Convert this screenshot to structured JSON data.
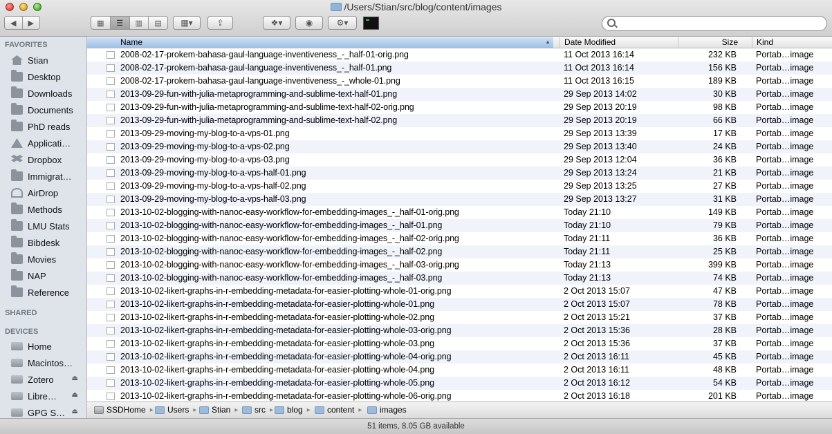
{
  "window": {
    "title": "/Users/Stian/src/blog/content/images"
  },
  "toolbar": {
    "back_icon": "back-arrow-icon",
    "forward_icon": "forward-arrow-icon",
    "views": [
      "icon-view",
      "list-view",
      "column-view",
      "coverflow-view"
    ],
    "active_view": "list-view",
    "search": {
      "value": "",
      "placeholder": ""
    }
  },
  "sidebar": {
    "favorites_label": "FAVORITES",
    "favorites": [
      {
        "label": "Stian",
        "icon": "home-icon"
      },
      {
        "label": "Desktop",
        "icon": "folder-icon"
      },
      {
        "label": "Downloads",
        "icon": "folder-icon"
      },
      {
        "label": "Documents",
        "icon": "folder-icon"
      },
      {
        "label": "PhD reads",
        "icon": "folder-icon"
      },
      {
        "label": "Applicati…",
        "icon": "applications-icon"
      },
      {
        "label": "Dropbox",
        "icon": "dropbox-icon"
      },
      {
        "label": "Immigrat…",
        "icon": "folder-icon"
      },
      {
        "label": "AirDrop",
        "icon": "airdrop-icon"
      },
      {
        "label": "Methods",
        "icon": "folder-icon"
      },
      {
        "label": "LMU Stats",
        "icon": "folder-icon"
      },
      {
        "label": "Bibdesk",
        "icon": "folder-icon"
      },
      {
        "label": "Movies",
        "icon": "folder-icon"
      },
      {
        "label": "NAP",
        "icon": "folder-icon"
      },
      {
        "label": "Reference",
        "icon": "folder-icon"
      }
    ],
    "shared_label": "SHARED",
    "devices_label": "DEVICES",
    "devices": [
      {
        "label": "Home",
        "icon": "disk-icon"
      },
      {
        "label": "Macintos…",
        "icon": "disk-icon"
      },
      {
        "label": "Zotero",
        "icon": "disk-icon",
        "eject": true
      },
      {
        "label": "Libre…",
        "icon": "disk-icon",
        "eject": true
      },
      {
        "label": "GPG S…",
        "icon": "disk-icon",
        "eject": true
      }
    ]
  },
  "columns": {
    "name": "Name",
    "date": "Date Modified",
    "size": "Size",
    "kind": "Kind"
  },
  "files": [
    {
      "name": "2008-02-17-prokem-bahasa-gaul-language-inventiveness_-_half-01-orig.png",
      "date": "11 Oct 2013 16:14",
      "size": "232 KB",
      "kind": "Portab…image"
    },
    {
      "name": "2008-02-17-prokem-bahasa-gaul-language-inventiveness_-_half-01.png",
      "date": "11 Oct 2013 16:14",
      "size": "156 KB",
      "kind": "Portab…image"
    },
    {
      "name": "2008-02-17-prokem-bahasa-gaul-language-inventiveness_-_whole-01.png",
      "date": "11 Oct 2013 16:15",
      "size": "189 KB",
      "kind": "Portab…image"
    },
    {
      "name": "2013-09-29-fun-with-julia-metaprogramming-and-sublime-text-half-01.png",
      "date": "29 Sep 2013 14:02",
      "size": "30 KB",
      "kind": "Portab…image"
    },
    {
      "name": "2013-09-29-fun-with-julia-metaprogramming-and-sublime-text-half-02-orig.png",
      "date": "29 Sep 2013 20:19",
      "size": "98 KB",
      "kind": "Portab…image"
    },
    {
      "name": "2013-09-29-fun-with-julia-metaprogramming-and-sublime-text-half-02.png",
      "date": "29 Sep 2013 20:19",
      "size": "66 KB",
      "kind": "Portab…image"
    },
    {
      "name": "2013-09-29-moving-my-blog-to-a-vps-01.png",
      "date": "29 Sep 2013 13:39",
      "size": "17 KB",
      "kind": "Portab…image"
    },
    {
      "name": "2013-09-29-moving-my-blog-to-a-vps-02.png",
      "date": "29 Sep 2013 13:40",
      "size": "24 KB",
      "kind": "Portab…image"
    },
    {
      "name": "2013-09-29-moving-my-blog-to-a-vps-03.png",
      "date": "29 Sep 2013 12:04",
      "size": "36 KB",
      "kind": "Portab…image"
    },
    {
      "name": "2013-09-29-moving-my-blog-to-a-vps-half-01.png",
      "date": "29 Sep 2013 13:24",
      "size": "21 KB",
      "kind": "Portab…image"
    },
    {
      "name": "2013-09-29-moving-my-blog-to-a-vps-half-02.png",
      "date": "29 Sep 2013 13:25",
      "size": "27 KB",
      "kind": "Portab…image"
    },
    {
      "name": "2013-09-29-moving-my-blog-to-a-vps-half-03.png",
      "date": "29 Sep 2013 13:27",
      "size": "31 KB",
      "kind": "Portab…image"
    },
    {
      "name": "2013-10-02-blogging-with-nanoc-easy-workflow-for-embedding-images_-_half-01-orig.png",
      "date": "Today 21:10",
      "size": "149 KB",
      "kind": "Portab…image"
    },
    {
      "name": "2013-10-02-blogging-with-nanoc-easy-workflow-for-embedding-images_-_half-01.png",
      "date": "Today 21:10",
      "size": "79 KB",
      "kind": "Portab…image"
    },
    {
      "name": "2013-10-02-blogging-with-nanoc-easy-workflow-for-embedding-images_-_half-02-orig.png",
      "date": "Today 21:11",
      "size": "36 KB",
      "kind": "Portab…image"
    },
    {
      "name": "2013-10-02-blogging-with-nanoc-easy-workflow-for-embedding-images_-_half-02.png",
      "date": "Today 21:11",
      "size": "25 KB",
      "kind": "Portab…image"
    },
    {
      "name": "2013-10-02-blogging-with-nanoc-easy-workflow-for-embedding-images_-_half-03-orig.png",
      "date": "Today 21:13",
      "size": "399 KB",
      "kind": "Portab…image"
    },
    {
      "name": "2013-10-02-blogging-with-nanoc-easy-workflow-for-embedding-images_-_half-03.png",
      "date": "Today 21:13",
      "size": "74 KB",
      "kind": "Portab…image"
    },
    {
      "name": "2013-10-02-likert-graphs-in-r-embedding-metadata-for-easier-plotting-whole-01-orig.png",
      "date": "2 Oct 2013 15:07",
      "size": "47 KB",
      "kind": "Portab…image"
    },
    {
      "name": "2013-10-02-likert-graphs-in-r-embedding-metadata-for-easier-plotting-whole-01.png",
      "date": "2 Oct 2013 15:07",
      "size": "78 KB",
      "kind": "Portab…image"
    },
    {
      "name": "2013-10-02-likert-graphs-in-r-embedding-metadata-for-easier-plotting-whole-02.png",
      "date": "2 Oct 2013 15:21",
      "size": "37 KB",
      "kind": "Portab…image"
    },
    {
      "name": "2013-10-02-likert-graphs-in-r-embedding-metadata-for-easier-plotting-whole-03-orig.png",
      "date": "2 Oct 2013 15:36",
      "size": "28 KB",
      "kind": "Portab…image"
    },
    {
      "name": "2013-10-02-likert-graphs-in-r-embedding-metadata-for-easier-plotting-whole-03.png",
      "date": "2 Oct 2013 15:36",
      "size": "37 KB",
      "kind": "Portab…image"
    },
    {
      "name": "2013-10-02-likert-graphs-in-r-embedding-metadata-for-easier-plotting-whole-04-orig.png",
      "date": "2 Oct 2013 16:11",
      "size": "45 KB",
      "kind": "Portab…image"
    },
    {
      "name": "2013-10-02-likert-graphs-in-r-embedding-metadata-for-easier-plotting-whole-04.png",
      "date": "2 Oct 2013 16:11",
      "size": "48 KB",
      "kind": "Portab…image"
    },
    {
      "name": "2013-10-02-likert-graphs-in-r-embedding-metadata-for-easier-plotting-whole-05.png",
      "date": "2 Oct 2013 16:12",
      "size": "54 KB",
      "kind": "Portab…image"
    },
    {
      "name": "2013-10-02-likert-graphs-in-r-embedding-metadata-for-easier-plotting-whole-06-orig.png",
      "date": "2 Oct 2013 16:18",
      "size": "201 KB",
      "kind": "Portab…image"
    }
  ],
  "pathbar": [
    {
      "label": "SSDHome",
      "icon": "disk-icon"
    },
    {
      "label": "Users",
      "icon": "folder-icon"
    },
    {
      "label": "Stian",
      "icon": "home-icon"
    },
    {
      "label": "src",
      "icon": "folder-icon"
    },
    {
      "label": "blog",
      "icon": "folder-icon"
    },
    {
      "label": "content",
      "icon": "folder-icon"
    },
    {
      "label": "images",
      "icon": "folder-icon"
    }
  ],
  "status": "51 items, 8.05 GB available"
}
